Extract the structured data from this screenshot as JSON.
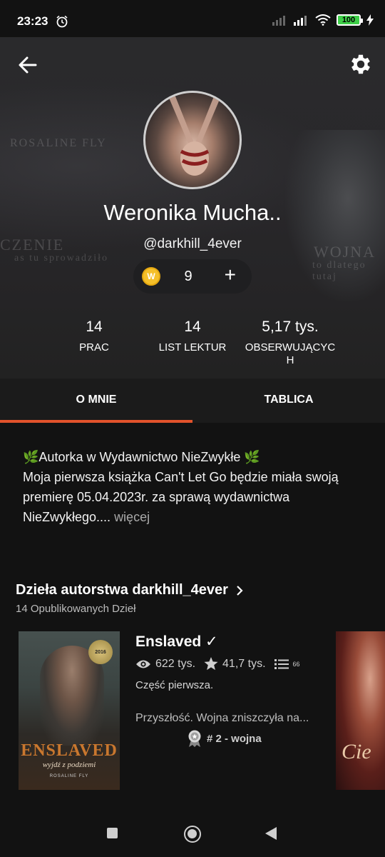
{
  "status_bar": {
    "time": "23:23",
    "battery": "100",
    "icons": [
      "alarm-icon",
      "signal-icon",
      "signal-icon",
      "wifi-icon",
      "battery-icon",
      "charging-icon"
    ]
  },
  "header": {
    "background_text": [
      "ROSALINE FLY",
      "CZENIE",
      "as tu sprowadziło",
      "WOJNA",
      "to dlatego tutaj"
    ],
    "back_icon": "arrow-left-icon",
    "settings_icon": "gear-icon"
  },
  "profile": {
    "name": "Weronika Mucha..",
    "username": "@darkhill_4ever",
    "coins": {
      "count": "9",
      "plus": "+",
      "logo": "W"
    }
  },
  "stats": [
    {
      "value": "14",
      "label": "PRAC"
    },
    {
      "value": "14",
      "label": "LIST LEKTUR"
    },
    {
      "value": "5,17 tys.",
      "label_line1": "OBSERWUJĄCYC",
      "label_line2": "H"
    }
  ],
  "tabs": [
    {
      "label": "O MNIE",
      "active": true
    },
    {
      "label": "TABLICA",
      "active": false
    }
  ],
  "about": {
    "line1": "Autorka w Wydawnictwo NieZwykłe",
    "line2": "Moja pierwsza książka Can't Let Go będzie miała swoją premierę 05.04.2023r. za sprawą wydawnictwa NieZwykłego....",
    "more": "więcej"
  },
  "works": {
    "title": "Dzieła autorstwa darkhill_4ever",
    "subtitle": "14 Opublikowanych Dzieł",
    "stories": [
      {
        "title": "Enslaved ✓",
        "reads": "622 tys.",
        "votes": "41,7 tys.",
        "parts": "66",
        "part_label": "Część pierwsza.",
        "description": "Przyszłość. Wojna zniszczyła na...",
        "rank": "# 2 - wojna",
        "cover_title": "ENSLAVED",
        "cover_subtitle": "wyjdź z podziemi",
        "cover_author": "ROSALINE FLY",
        "cover_badge": "2016"
      }
    ],
    "next_cover_text": "Cie"
  },
  "accent_color": "#e2522b"
}
